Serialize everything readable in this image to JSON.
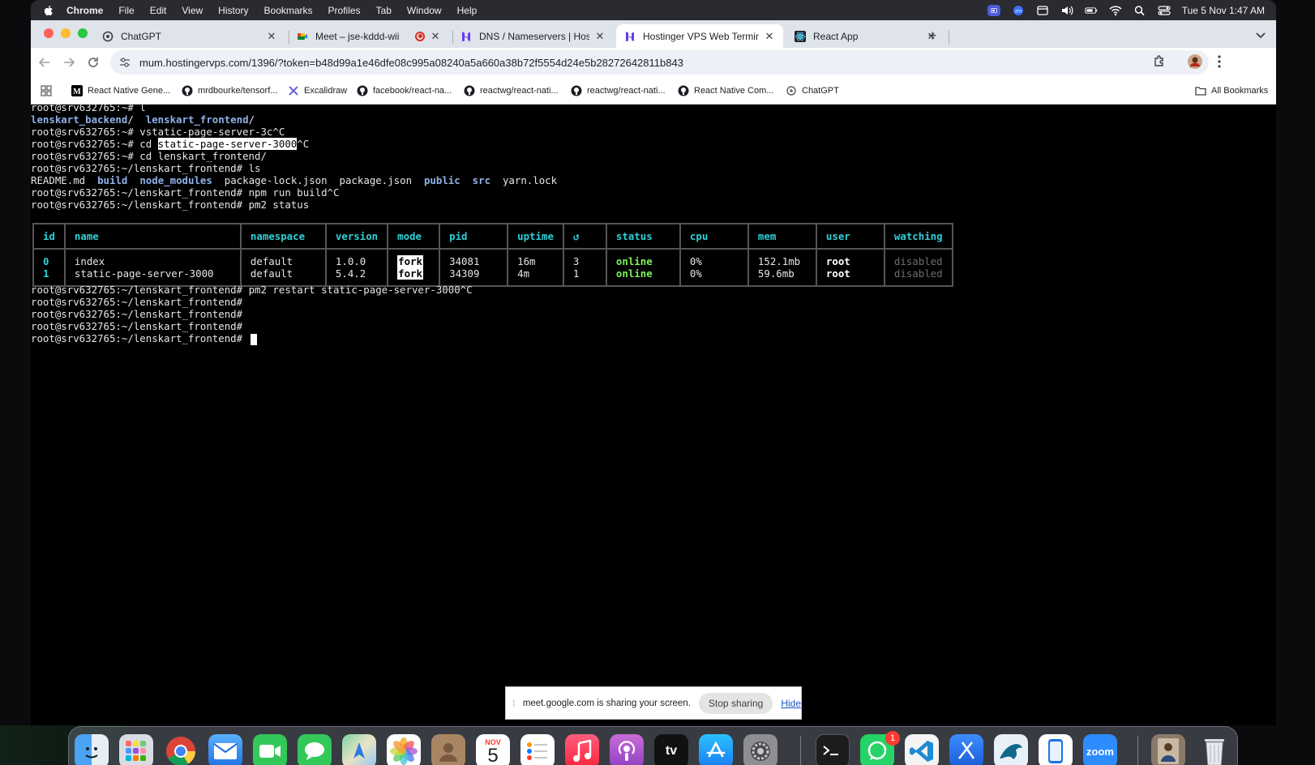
{
  "menubar": {
    "app": "Chrome",
    "items": [
      "File",
      "Edit",
      "View",
      "History",
      "Bookmarks",
      "Profiles",
      "Tab",
      "Window",
      "Help"
    ],
    "clock": "Tue 5 Nov  1:47 AM"
  },
  "tabs": [
    {
      "title": "ChatGPT",
      "icon": "chatgpt-icon"
    },
    {
      "title": "Meet – jse-kddd-wii",
      "icon": "google-meet-icon"
    },
    {
      "title": "DNS / Nameservers | Hosting",
      "icon": "hostinger-icon"
    },
    {
      "title": "Hostinger VPS Web Terminal",
      "icon": "hostinger-icon"
    },
    {
      "title": "React App",
      "icon": "react-icon"
    }
  ],
  "omnibox": {
    "url": "mum.hostingervps.com/1396/?token=b48d99a1e46dfe08c995a08240a5a660a38b72f5554d24e5b28272642811b843"
  },
  "bookmarks": {
    "items": [
      {
        "label": "React Native Gene...",
        "icon": "medium-icon"
      },
      {
        "label": "mrdbourke/tensorf...",
        "icon": "github-icon"
      },
      {
        "label": "Excalidraw",
        "icon": "excalidraw-icon"
      },
      {
        "label": "facebook/react-na...",
        "icon": "github-icon"
      },
      {
        "label": "reactwg/react-nati...",
        "icon": "github-icon"
      },
      {
        "label": "reactwg/react-nati...",
        "icon": "github-icon"
      },
      {
        "label": "React Native Com...",
        "icon": "github-icon"
      },
      {
        "label": "ChatGPT",
        "icon": "chatgpt-icon"
      }
    ],
    "all_bookmarks": "All Bookmarks"
  },
  "terminal": {
    "prompt_home": "root@srv632765:~# ",
    "prompt_fe": "root@srv632765:~/lenskart_frontend# ",
    "lines": {
      "l1_cmd": "l",
      "dir1": "lenskart_backend",
      "dir1_slash": "/  ",
      "dir2": "lenskart_frontend",
      "dir2_slash": "/",
      "l3_cmd": "vstatic-page-server-3c^C",
      "l4_cd": "cd ",
      "l4_sel": "static-page-server-3000",
      "l4_tail": "^C",
      "l5_cmd": "cd lenskart_frontend/",
      "l6_cmd": "ls",
      "ls_readme": "README.md ",
      "ls_build": "build",
      "ls_node_modules": "node_modules",
      "ls_pkglock": "package-lock.json",
      "ls_pkg": "package.json",
      "ls_public": "public",
      "ls_src": "src",
      "ls_yarn": "yarn.lock",
      "l8_cmd": "npm run build^C",
      "l9_cmd": "pm2 status",
      "after_cmd": "pm2 restart static-page-server-3000^C"
    },
    "pm2_headers": [
      "id",
      "name",
      "namespace",
      "version",
      "mode",
      "pid",
      "uptime",
      "↺",
      "status",
      "cpu",
      "mem",
      "user",
      "watching"
    ],
    "pm2_rows": [
      {
        "id": "0",
        "name": "index",
        "namespace": "default",
        "version": "1.0.0",
        "mode": "fork",
        "pid": "34081",
        "uptime": "16m",
        "restarts": "3",
        "status": "online",
        "cpu": "0%",
        "mem": "152.1mb",
        "user": "root",
        "watching": "disabled"
      },
      {
        "id": "1",
        "name": "static-page-server-3000",
        "namespace": "default",
        "version": "5.4.2",
        "mode": "fork",
        "pid": "34309",
        "uptime": "4m",
        "restarts": "1",
        "status": "online",
        "cpu": "0%",
        "mem": "59.6mb",
        "user": "root",
        "watching": "disabled"
      }
    ]
  },
  "share_bar": {
    "message": "meet.google.com is sharing your screen.",
    "stop": "Stop sharing",
    "hide": "Hide"
  },
  "dock": {
    "calendar_month": "NOV",
    "calendar_day": "5",
    "whatsapp_badge": "1",
    "zoom_label": "zoom",
    "tv_label": "tv"
  },
  "colors": {
    "terminal_bg": "#000000",
    "pm2_header": "#2fd0d8",
    "online": "#7cf25b",
    "dir_blue": "#8fb1e8"
  }
}
